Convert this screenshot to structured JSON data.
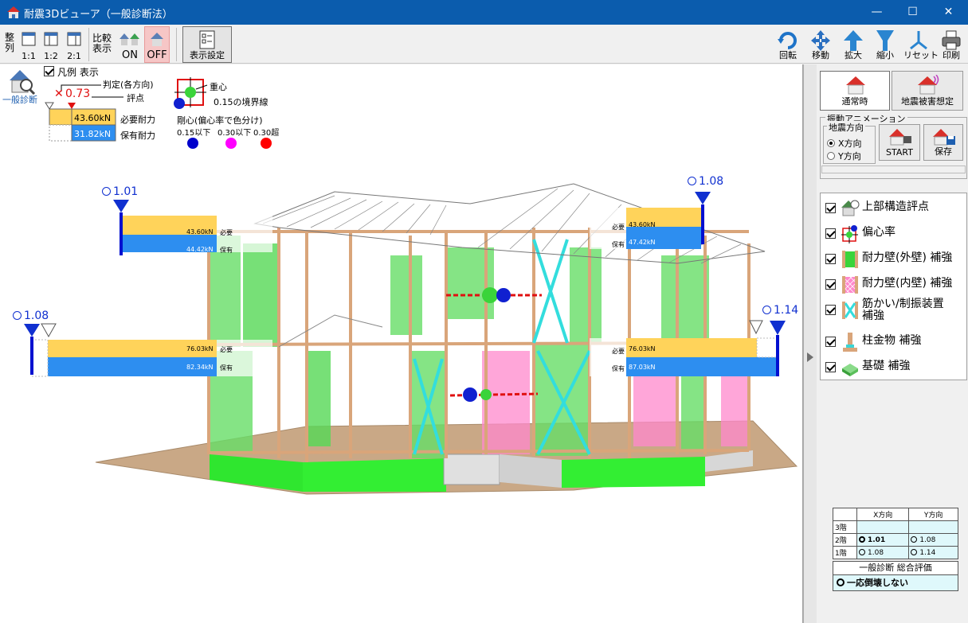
{
  "window": {
    "title": "耐震3Dビューア（一般診断法）",
    "minimize": "—",
    "maximize": "☐",
    "close": "✕"
  },
  "toolbar": {
    "arrange_label": "整列",
    "layout_1_1": "1:1",
    "layout_1_2": "1:2",
    "layout_2_1": "2:1",
    "compare_label": "比較表示",
    "compare_on": "ON",
    "compare_off": "OFF",
    "display_settings": "表示設定",
    "rotate": "回転",
    "move": "移動",
    "zoom_in": "拡大",
    "zoom_out": "縮小",
    "reset": "リセット",
    "print": "印刷"
  },
  "legend": {
    "mode_label": "一般診断",
    "show_legend": "凡例 表示",
    "judgement": "判定(各方向)",
    "score_symbol": "✕",
    "score_value": "0.73",
    "score_label": "評点",
    "required_value": "43.60kN",
    "required_label": "必要耐力",
    "held_value": "31.82kN",
    "held_label": "保有耐力",
    "center_of_gravity": "重心",
    "boundary": "0.15の境界線",
    "rigidity_title": "剛心(偏心率で色分け)",
    "rigidity_levels": [
      "0.15以下",
      "0.30以下",
      "0.30超"
    ],
    "colors": {
      "low": "#0000cc",
      "mid": "#ff00ff",
      "high": "#ff0000"
    }
  },
  "markers": [
    {
      "name": "upper-left",
      "value": "1.01"
    },
    {
      "name": "upper-right",
      "value": "1.08"
    },
    {
      "name": "lower-left",
      "value": "1.08"
    },
    {
      "name": "lower-right",
      "value": "1.14"
    }
  ],
  "bars": {
    "upper_left": {
      "required": "43.60kN",
      "held": "44.42kN",
      "req_tag": "必要",
      "held_tag": "保有"
    },
    "upper_right": {
      "required": "43.60kN",
      "held": "47.42kN",
      "req_tag": "必要",
      "held_tag": "保有"
    },
    "lower_left": {
      "required": "76.03kN",
      "held": "82.34kN",
      "req_tag": "必要",
      "held_tag": "保有"
    },
    "lower_right": {
      "required": "76.03kN",
      "held": "87.03kN",
      "req_tag": "必要",
      "held_tag": "保有"
    }
  },
  "panel": {
    "normal": "通常時",
    "damage": "地震被害想定",
    "animation_group": "振動アニメーション",
    "direction_group": "地震方向",
    "x_direction": "X方向",
    "y_direction": "Y方向",
    "start": "START",
    "save": "保存",
    "layers": [
      {
        "id": "upper-structure",
        "label": "上部構造評点"
      },
      {
        "id": "eccentricity",
        "label": "偏心率"
      },
      {
        "id": "outer-wall",
        "label": "耐力壁(外壁) 補強"
      },
      {
        "id": "inner-wall",
        "label": "耐力壁(内壁) 補強"
      },
      {
        "id": "brace",
        "label": "筋かい/制振装置",
        "label2": "補強"
      },
      {
        "id": "column-hardware",
        "label": "柱金物 補強"
      },
      {
        "id": "foundation",
        "label": "基礎 補強"
      }
    ]
  },
  "results": {
    "x_header": "X方向",
    "y_header": "Y方向",
    "rows": [
      {
        "floor": "3階",
        "x": "",
        "y": ""
      },
      {
        "floor": "2階",
        "x": "1.01",
        "y": "1.08"
      },
      {
        "floor": "1階",
        "x": "1.08",
        "y": "1.14"
      }
    ],
    "overall_title": "一般診断 総合評価",
    "overall_value": "一応倒壊しない"
  }
}
